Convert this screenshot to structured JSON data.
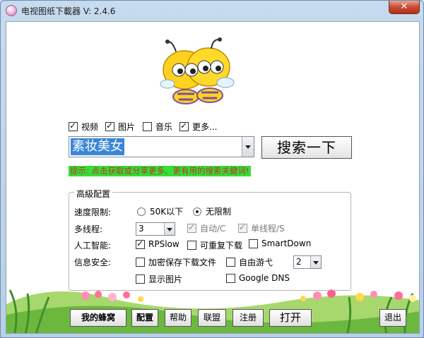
{
  "window": {
    "title": "电视图纸下載器 V: 2.4.6",
    "close_glyph": "✕"
  },
  "filters": [
    {
      "label": "视频",
      "checked": true
    },
    {
      "label": "图片",
      "checked": true
    },
    {
      "label": "音乐",
      "checked": false
    },
    {
      "label": "更多...",
      "checked": true
    }
  ],
  "search": {
    "value": "素妆美女",
    "button_label": "搜索一下"
  },
  "hint": "提示: 点击获取或分享更多、更有用的搜索关鍵词!",
  "advanced": {
    "title": "高級配置",
    "speed": {
      "label": "速度限制:",
      "options": [
        "50K以下",
        "无限制"
      ],
      "selected": "无限制"
    },
    "threads": {
      "label": "多线程:",
      "value": "3",
      "auto_label": "自动/C",
      "single_label": "单线程/S"
    },
    "ai": {
      "label": "人工智能:",
      "rpslow": "RPSlow",
      "repeat": "可重复下载",
      "smartdown": "SmartDown"
    },
    "security": {
      "label": "信息安全:",
      "encrypt": "加密保存下载文件",
      "free_cruise": "自由游弋",
      "cruise_value": "2",
      "show_images": "显示图片",
      "google_dns": "Google DNS"
    }
  },
  "buttons": {
    "hive": "我的蜂窝",
    "config": "配置",
    "help": "帮助",
    "league": "联盟",
    "register": "注册",
    "open": "打开",
    "exit": "退出"
  },
  "colors": {
    "hint_bg": "#33e033",
    "hint_text": "#c03030",
    "selection": "#3b86d8"
  }
}
